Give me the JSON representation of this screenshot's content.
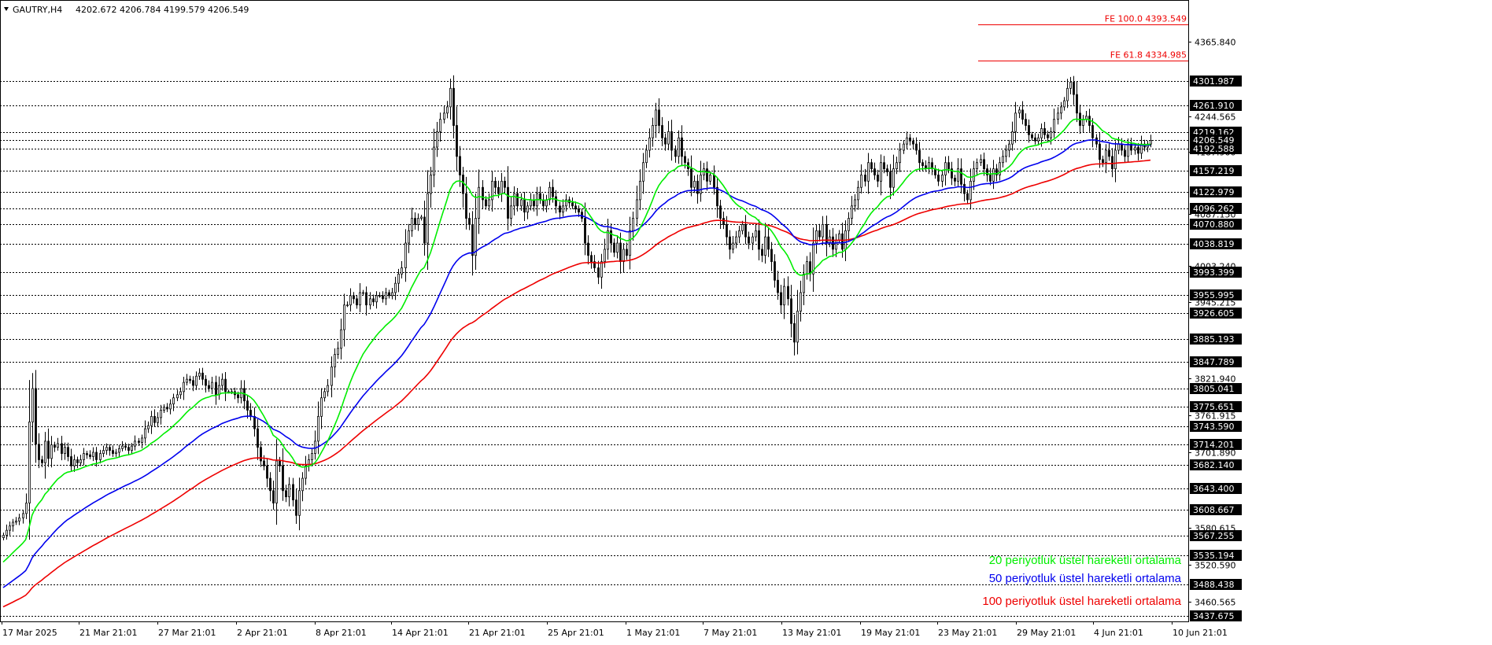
{
  "header": {
    "symbol": "GAUTRY,H4",
    "ohlc": "4202.672 4206.784 4199.579 4206.549"
  },
  "colors": {
    "ema20": "#00ee00",
    "ema50": "#0000ee",
    "ema100": "#ee0000",
    "fibo": "#ee0000",
    "candle": "#000000",
    "grid": "#000000",
    "background": "#ffffff"
  },
  "chart_data": {
    "type": "line",
    "title": "",
    "ylim": [
      3437.675,
      4420
    ],
    "x_labels": [
      "17 Mar 2025",
      "21 Mar 21:01",
      "27 Mar 21:01",
      "2 Apr 21:01",
      "8 Apr 21:01",
      "14 Apr 21:01",
      "21 Apr 21:01",
      "25 Apr 21:01",
      "1 May 21:01",
      "7 May 21:01",
      "13 May 21:01",
      "19 May 21:01",
      "23 May 21:01",
      "29 May 21:01",
      "4 Jun 21:01",
      "10 Jun 21:01"
    ],
    "y_ticks": [
      4365.84,
      4244.565,
      4187.9,
      4087.15,
      4003.24,
      3945.215,
      3821.94,
      3761.915,
      3701.89,
      3580.615,
      3520.59,
      3460.565
    ],
    "levels": [
      4301.987,
      4261.91,
      4219.162,
      4206.549,
      4192.588,
      4157.219,
      4122.979,
      4096.262,
      4070.88,
      4038.819,
      3993.399,
      3955.995,
      3926.605,
      3885.193,
      3847.789,
      3805.041,
      3775.651,
      3743.59,
      3714.201,
      3682.14,
      3643.4,
      3608.667,
      3567.255,
      3535.194,
      3488.438,
      3437.675
    ],
    "fibo_levels": [
      {
        "label": "FE 100.0 4393.549",
        "value": 4393.549
      },
      {
        "label": "FE 61.8 4334.985",
        "value": 4334.985
      }
    ],
    "candles": [
      3568,
      3576,
      3583,
      3589,
      3591,
      3596,
      3603,
      3620,
      3751,
      3805,
      3715,
      3690,
      3685,
      3720,
      3692,
      3714,
      3710,
      3716,
      3700,
      3710,
      3695,
      3680,
      3690,
      3685,
      3690,
      3700,
      3698,
      3695,
      3702,
      3690,
      3700,
      3705,
      3710,
      3705,
      3700,
      3702,
      3708,
      3712,
      3710,
      3705,
      3712,
      3720,
      3718,
      3725,
      3740,
      3745,
      3760,
      3750,
      3758,
      3770,
      3775,
      3772,
      3780,
      3790,
      3795,
      3800,
      3815,
      3820,
      3818,
      3810,
      3825,
      3830,
      3820,
      3810,
      3805,
      3815,
      3795,
      3810,
      3820,
      3800,
      3800,
      3800,
      3795,
      3790,
      3805,
      3785,
      3770,
      3760,
      3740,
      3710,
      3688,
      3680,
      3660,
      3640,
      3620,
      3688,
      3680,
      3640,
      3630,
      3650,
      3625,
      3600,
      3640,
      3660,
      3680,
      3690,
      3700,
      3720,
      3760,
      3790,
      3800,
      3810,
      3840,
      3860,
      3870,
      3900,
      3940,
      3940,
      3955,
      3950,
      3940,
      3960,
      3960,
      3940,
      3950,
      3945,
      3955,
      3955,
      3950,
      3960,
      3955,
      3960,
      3975,
      3990,
      4000,
      4040,
      4060,
      4080,
      4070,
      4080,
      4082,
      4040,
      4120,
      4150,
      4195,
      4220,
      4240,
      4250,
      4260,
      4290,
      4230,
      4180,
      4150,
      4120,
      4080,
      4070,
      4020,
      4080,
      4130,
      4110,
      4100,
      4110,
      4140,
      4130,
      4120,
      4140,
      4130,
      4080,
      4100,
      4120,
      4100,
      4110,
      4090,
      4100,
      4110,
      4100,
      4120,
      4110,
      4100,
      4110,
      4130,
      4115,
      4100,
      4090,
      4100,
      4110,
      4105,
      4100,
      4095,
      4090,
      4080,
      4040,
      4020,
      4010,
      4000,
      3985,
      4010,
      4030,
      4060,
      4040,
      4025,
      4040,
      4010,
      4030,
      4020,
      4060,
      4080,
      4110,
      4140,
      4170,
      4190,
      4210,
      4230,
      4255,
      4230,
      4210,
      4200,
      4220,
      4190,
      4180,
      4210,
      4180,
      4170,
      4160,
      4130,
      4140,
      4120,
      4150,
      4160,
      4140,
      4150,
      4130,
      4100,
      4080,
      4070,
      4050,
      4030,
      4040,
      4050,
      4060,
      4070,
      4050,
      4040,
      4050,
      4060,
      4030,
      4020,
      4050,
      4030,
      4010,
      3980,
      3960,
      3940,
      3970,
      3950,
      3910,
      3880,
      3930,
      3960,
      3990,
      4010,
      3990,
      4040,
      4060,
      4050,
      4070,
      4040,
      4050,
      4030,
      4045,
      4055,
      4030,
      4060,
      4080,
      4100,
      4110,
      4130,
      4150,
      4140,
      4170,
      4160,
      4150,
      4140,
      4170,
      4160,
      4155,
      4130,
      4160,
      4170,
      4190,
      4200,
      4210,
      4205,
      4200,
      4190,
      4170,
      4165,
      4160,
      4170,
      4160,
      4150,
      4140,
      4150,
      4170,
      4160,
      4145,
      4140,
      4160,
      4135,
      4120,
      4110,
      4140,
      4160,
      4170,
      4175,
      4160,
      4150,
      4140,
      4160,
      4150,
      4170,
      4180,
      4190,
      4200,
      4220,
      4250,
      4255,
      4240,
      4230,
      4215,
      4210,
      4205,
      4210,
      4225,
      4215,
      4210,
      4220,
      4240,
      4250,
      4260,
      4270,
      4290,
      4300,
      4280,
      4250,
      4230,
      4240,
      4245,
      4230,
      4210,
      4200,
      4175,
      4170,
      4190,
      4180,
      4160,
      4190,
      4200,
      4190,
      4180,
      4200,
      4190,
      4195,
      4185,
      4200,
      4195,
      4200,
      4206
    ]
  },
  "legend": {
    "ema20": "20 periyotluk üstel hareketli ortalama",
    "ema50": "50 periyotluk üstel hareketli ortalama",
    "ema100": "100 periyotluk üstel hareketli ortalama"
  }
}
